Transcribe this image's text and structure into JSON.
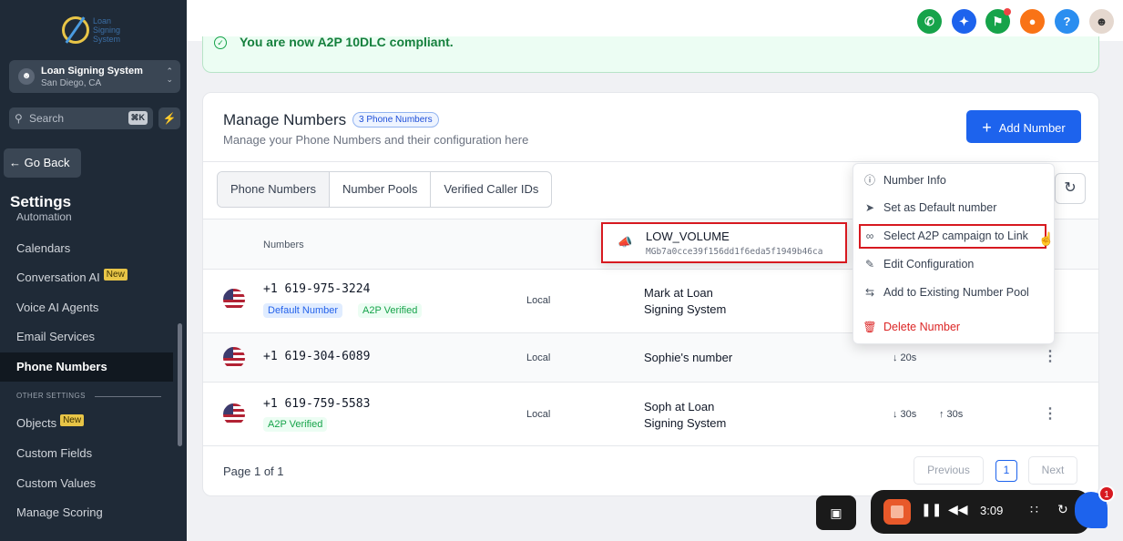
{
  "app": {
    "logo_text": "Loan\nSigning\nSystem",
    "location_name": "Loan Signing System",
    "location_city": "San Diego, CA"
  },
  "sidebar": {
    "search_placeholder": "Search",
    "search_shortcut": "⌘K",
    "go_back_label": "← Go Back",
    "settings_title": "Settings",
    "cut_item": "Automation",
    "items": [
      {
        "label": "Calendars"
      },
      {
        "label": "Conversation AI",
        "badge": "New"
      },
      {
        "label": "Voice AI Agents"
      },
      {
        "label": "Email Services"
      },
      {
        "label": "Phone Numbers",
        "active": true
      },
      {
        "label": "Objects",
        "badge": "New"
      },
      {
        "label": "Custom Fields"
      },
      {
        "label": "Custom Values"
      },
      {
        "label": "Manage Scoring"
      }
    ],
    "section_label": "OTHER SETTINGS"
  },
  "banner": {
    "text": "You are now A2P 10DLC compliant."
  },
  "manage": {
    "title": "Manage Numbers",
    "count_pill": "3 Phone Numbers",
    "subtitle": "Manage your Phone Numbers and their configuration here",
    "add_button": "Add Number",
    "tabs": [
      "Phone Numbers",
      "Number Pools",
      "Verified Caller IDs"
    ],
    "column_numbers": "Numbers"
  },
  "rows": [
    {
      "number": "+1 619-975-3224",
      "tags": [
        "Default Number",
        "A2P Verified"
      ],
      "type": "Local",
      "name_line1": "Mark at Loan",
      "name_line2": "Signing System",
      "in": "",
      "out": ""
    },
    {
      "number": "+1 619-304-6089",
      "tags": [],
      "type": "Local",
      "name_line1": "Sophie's number",
      "name_line2": "",
      "in": "↓ 20s",
      "out": ""
    },
    {
      "number": "+1 619-759-5583",
      "tags": [
        "A2P Verified"
      ],
      "type": "Local",
      "name_line1": "Soph at Loan",
      "name_line2": "Signing System",
      "in": "↓ 30s",
      "out": "↑ 30s"
    }
  ],
  "pagination": {
    "label": "Page 1 of 1",
    "previous": "Previous",
    "current": "1",
    "next": "Next"
  },
  "dropdown": {
    "items": [
      {
        "label": "Number Info",
        "icon": "info-icon"
      },
      {
        "label": "Set as Default number",
        "icon": "pin-icon"
      },
      {
        "label": "Select A2P campaign to Link",
        "icon": "link-icon"
      },
      {
        "label": "Edit Configuration",
        "icon": "pencil-icon"
      },
      {
        "label": "Add to Existing Number Pool",
        "icon": "swap-icon"
      },
      {
        "label": "Delete Number",
        "icon": "trash-icon",
        "danger": true
      }
    ]
  },
  "campaign_popup": {
    "title": "LOW_VOLUME",
    "id": "MGb7a0cce39f156dd1f6eda5f1949b46ca"
  },
  "recorder": {
    "time": "3:09",
    "notification_count": "1"
  },
  "colors": {
    "sidebar_bg": "#1f2a37",
    "primary": "#1d63ed",
    "highlight_red": "#d71920",
    "success": "#16a34a"
  }
}
